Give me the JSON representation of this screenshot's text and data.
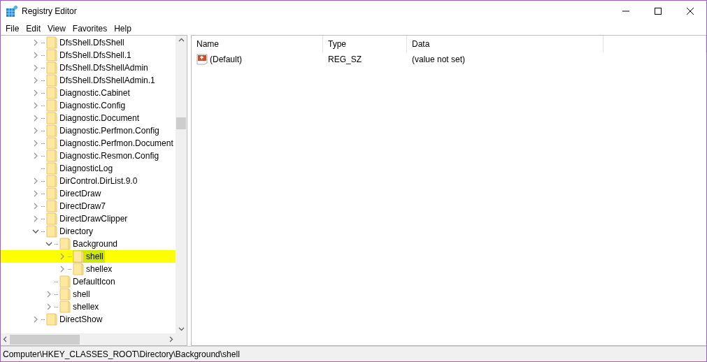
{
  "window": {
    "title": "Registry Editor"
  },
  "menu": [
    "File",
    "Edit",
    "View",
    "Favorites",
    "Help"
  ],
  "tree": [
    {
      "label": "DfsShell.DfsShell",
      "expandable": true,
      "expanded": false,
      "selected": false
    },
    {
      "label": "DfsShell.DfsShell.1",
      "expandable": true,
      "expanded": false,
      "selected": false
    },
    {
      "label": "DfsShell.DfsShellAdmin",
      "expandable": true,
      "expanded": false,
      "selected": false
    },
    {
      "label": "DfsShell.DfsShellAdmin.1",
      "expandable": true,
      "expanded": false,
      "selected": false
    },
    {
      "label": "Diagnostic.Cabinet",
      "expandable": true,
      "expanded": false,
      "selected": false
    },
    {
      "label": "Diagnostic.Config",
      "expandable": true,
      "expanded": false,
      "selected": false
    },
    {
      "label": "Diagnostic.Document",
      "expandable": true,
      "expanded": false,
      "selected": false
    },
    {
      "label": "Diagnostic.Perfmon.Config",
      "expandable": true,
      "expanded": false,
      "selected": false
    },
    {
      "label": "Diagnostic.Perfmon.Document",
      "expandable": true,
      "expanded": false,
      "selected": false
    },
    {
      "label": "Diagnostic.Resmon.Config",
      "expandable": true,
      "expanded": false,
      "selected": false
    },
    {
      "label": "DiagnosticLog",
      "expandable": false,
      "selected": false
    },
    {
      "label": "DirControl.DirList.9.0",
      "expandable": true,
      "expanded": false,
      "selected": false
    },
    {
      "label": "DirectDraw",
      "expandable": true,
      "expanded": false,
      "selected": false
    },
    {
      "label": "DirectDraw7",
      "expandable": true,
      "expanded": false,
      "selected": false
    },
    {
      "label": "DirectDrawClipper",
      "expandable": true,
      "expanded": false,
      "selected": false
    },
    {
      "label": "Directory",
      "expandable": true,
      "expanded": true,
      "selected": false,
      "children": [
        {
          "label": "Background",
          "expandable": true,
          "expanded": true,
          "selected": false,
          "children": [
            {
              "label": "shell",
              "expandable": true,
              "expanded": false,
              "selected": true
            },
            {
              "label": "shellex",
              "expandable": true,
              "expanded": false,
              "selected": false
            }
          ]
        },
        {
          "label": "DefaultIcon",
          "expandable": false,
          "selected": false
        },
        {
          "label": "shell",
          "expandable": true,
          "expanded": false,
          "selected": false
        },
        {
          "label": "shellex",
          "expandable": true,
          "expanded": false,
          "selected": false
        }
      ]
    },
    {
      "label": "DirectShow",
      "expandable": true,
      "expanded": false,
      "selected": false
    }
  ],
  "table": {
    "columns": [
      "Name",
      "Type",
      "Data"
    ],
    "rows": [
      {
        "name": "(Default)",
        "type": "REG_SZ",
        "data": "(value not set)"
      }
    ]
  },
  "status_bar": "Computer\\HKEY_CLASSES_ROOT\\Directory\\Background\\shell"
}
